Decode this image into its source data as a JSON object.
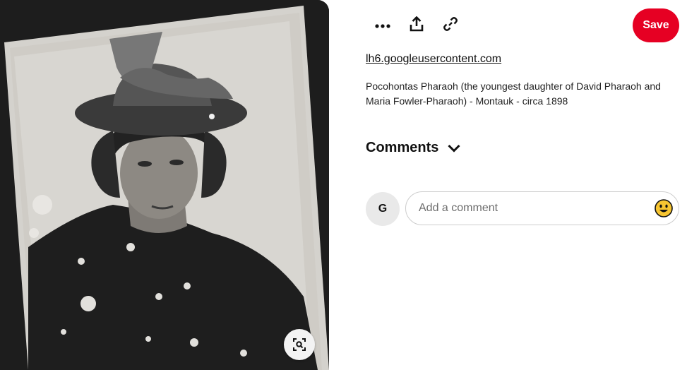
{
  "image": {
    "alt": "Pocohontas Pharaoh (the youngest daughter of David Pharaoh and Maria Fowler-Pharaoh) - Montauk - circa 1898",
    "lens_icon": "visual-search-icon"
  },
  "toolbar": {
    "more_icon": "more-dots-icon",
    "share_icon": "share-upload-icon",
    "link_icon": "link-icon",
    "save_label": "Save",
    "save_color": "#e60023"
  },
  "pin": {
    "source": "lh6.googleusercontent.com",
    "description": "Pocohontas Pharaoh (the youngest daughter of David Pharaoh and Maria Fowler-Pharaoh) - Montauk - circa 1898"
  },
  "comments": {
    "title": "Comments",
    "avatar_initial": "G",
    "placeholder": "Add a comment",
    "emoji_icon": "smiley-emoji-icon"
  }
}
